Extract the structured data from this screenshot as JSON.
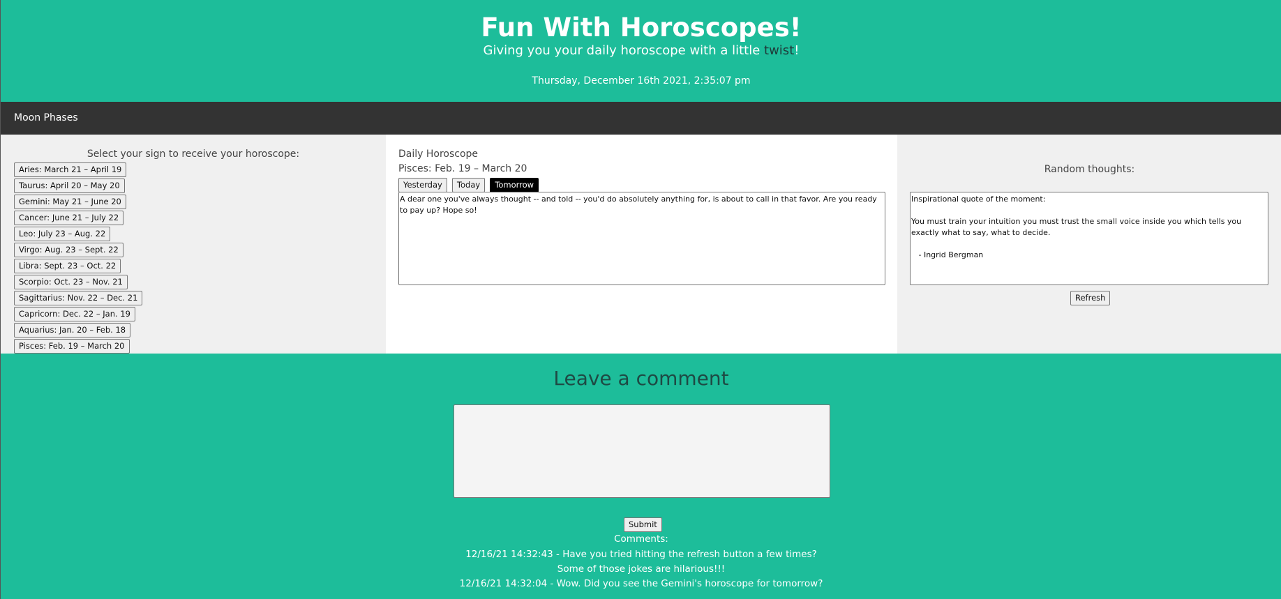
{
  "header": {
    "title": "Fun With Horoscopes!",
    "tagline_before": "Giving you your daily horoscope with a little ",
    "tagline_twist": "twist",
    "tagline_after": "!",
    "datetime": "Thursday, December 16th 2021, 2:35:07 pm"
  },
  "nav": {
    "moon_phases": "Moon Phases"
  },
  "signs": {
    "prompt": "Select your sign to receive your horoscope:",
    "items": [
      "Aries: March 21 – April 19",
      "Taurus: April 20 – May 20",
      "Gemini: May 21 – June 20",
      "Cancer: June 21 – July 22",
      "Leo: July 23 – Aug. 22",
      "Virgo: Aug. 23 – Sept. 22",
      "Libra: Sept. 23 – Oct. 22",
      "Scorpio: Oct. 23 – Nov. 21",
      "Sagittarius: Nov. 22 – Dec. 21",
      "Capricorn: Dec. 22 – Jan. 19",
      "Aquarius: Jan. 20 – Feb. 18",
      "Pisces: Feb. 19 – March 20"
    ]
  },
  "horoscope": {
    "title": "Daily Horoscope",
    "sign": "Pisces: Feb. 19 – March 20",
    "tabs": [
      "Yesterday",
      "Today",
      "Tomorrow"
    ],
    "active_tab": "Tomorrow",
    "text": "A dear one you've always thought -- and told -- you'd do absolutely anything for, is about to call in that favor. Are you ready to pay up? Hope so!"
  },
  "random": {
    "title": "Random thoughts:",
    "quote_label": "Inspirational quote of the moment:",
    "quote_text": "You must train your intuition you must trust the small voice inside you which tells you exactly what to say, what to decide.",
    "quote_author": "   - Ingrid Bergman",
    "refresh_label": "Refresh"
  },
  "comments": {
    "heading": "Leave a comment",
    "submit_label": "Submit",
    "label": "Comments:",
    "items": [
      "12/16/21 14:32:43 - Have you tried hitting the refresh button a few times? Some of those jokes are hilarious!!!",
      "12/16/21 14:32:04 - Wow. Did you see the Gemini's horoscope for tomorrow?"
    ]
  },
  "colors": {
    "brand_teal": "#1dbd9a",
    "nav_dark": "#333333",
    "twist": "#1f3b3a",
    "active_tab": "#000000"
  }
}
